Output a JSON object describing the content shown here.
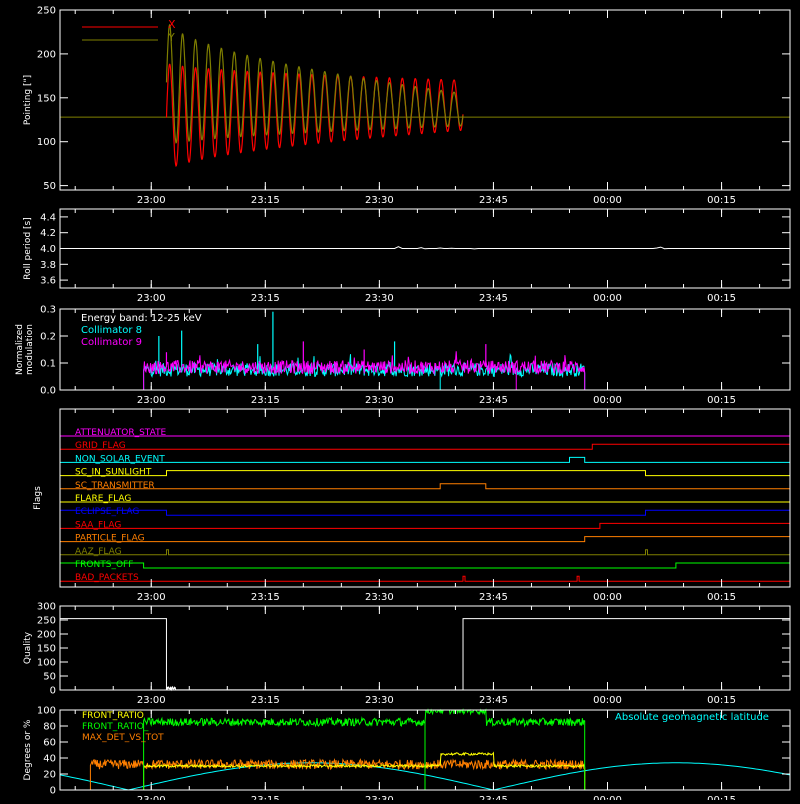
{
  "colors": {
    "background": "#000000",
    "axis": "#ffffff",
    "red": "#ff0000",
    "olive": "#7f7f00",
    "cyan": "#00ffff",
    "magenta": "#ff00ff",
    "white": "#ffffff",
    "yellow": "#ffff00",
    "green": "#00ff00",
    "orange": "#ff7f00",
    "blue": "#0000ff"
  },
  "time_axis": {
    "start": "22:48",
    "end": "00:24",
    "tick_labels": [
      "23:00",
      "23:15",
      "23:30",
      "23:45",
      "00:00",
      "00:15"
    ]
  },
  "chart_data": [
    {
      "id": "pointing",
      "type": "area",
      "ylabel": "Pointing [\"]",
      "ylim": [
        45,
        250
      ],
      "y_ticks": [
        50,
        100,
        150,
        200,
        250
      ],
      "series": [
        {
          "name": "X",
          "color": "#ff0000",
          "baseline": 128,
          "active_from": "23:02",
          "active_to": "23:41",
          "start_low": 65,
          "start_high": 190,
          "end_low": 113,
          "end_high": 170
        },
        {
          "name": "Y",
          "color": "#7f7f00",
          "baseline": 128,
          "active_from": "23:02",
          "active_to": "23:41",
          "start_low": 95,
          "start_high": 240,
          "end_low": 118,
          "end_high": 155
        }
      ]
    },
    {
      "id": "roll",
      "type": "line",
      "ylabel": "Roll period [s]",
      "ylim": [
        3.5,
        4.5
      ],
      "y_ticks": [
        3.6,
        3.8,
        4.0,
        4.2,
        4.4
      ],
      "series": [
        {
          "name": "",
          "color": "#ffffff",
          "value": 4.0
        }
      ]
    },
    {
      "id": "modulation",
      "type": "line",
      "ylabel": "Normalized modulation",
      "ylim": [
        0,
        0.3
      ],
      "y_ticks": [
        0.0,
        0.1,
        0.2,
        0.3
      ],
      "legend_title": "Energy band: 12-25 keV",
      "series": [
        {
          "name": "Collimator 8",
          "color": "#00ffff",
          "active_from": "22:59",
          "active_to": "23:57",
          "baseline": 0.075,
          "noise": 0.05,
          "spikes": [
            [
              "23:01",
              0.2
            ],
            [
              "23:04",
              0.22
            ],
            [
              "23:16",
              0.29
            ],
            [
              "23:14",
              0.17
            ],
            [
              "23:32",
              0.18
            ]
          ]
        },
        {
          "name": "Collimator 9",
          "color": "#ff00ff",
          "active_from": "22:59",
          "active_to": "23:57",
          "baseline": 0.085,
          "noise": 0.05,
          "spikes": [
            [
              "23:02",
              0.14
            ],
            [
              "23:20",
              0.18
            ],
            [
              "23:28",
              0.15
            ],
            [
              "23:44",
              0.17
            ]
          ]
        }
      ]
    },
    {
      "id": "flags",
      "type": "line",
      "ylabel": "Flags",
      "series": [
        {
          "name": "ATTENUATOR_STATE",
          "color": "#ff00ff",
          "on": []
        },
        {
          "name": "GRID_FLAG",
          "color": "#ff0000",
          "on": [
            [
              "23:58",
              "00:24"
            ]
          ]
        },
        {
          "name": "NON_SOLAR_EVENT",
          "color": "#00ffff",
          "on": [
            [
              "23:55",
              "23:57"
            ]
          ]
        },
        {
          "name": "SC_IN_SUNLIGHT",
          "color": "#ffff00",
          "on": [
            [
              "23:02",
              "00:05"
            ]
          ]
        },
        {
          "name": "SC_TRANSMITTER",
          "color": "#ff7f00",
          "on": [
            [
              "23:38",
              "23:44"
            ]
          ]
        },
        {
          "name": "FLARE_FLAG",
          "color": "#ffff00",
          "on": []
        },
        {
          "name": "ECLIPSE_FLAG",
          "color": "#0000ff",
          "on": [
            [
              "22:48",
              "23:02"
            ],
            [
              "00:05",
              "00:24"
            ]
          ]
        },
        {
          "name": "SAA_FLAG",
          "color": "#ff0000",
          "on": [
            [
              "23:59",
              "00:24"
            ]
          ]
        },
        {
          "name": "PARTICLE_FLAG",
          "color": "#ff7f00",
          "on": [
            [
              "23:57",
              "00:24"
            ]
          ]
        },
        {
          "name": "AAZ_FLAG",
          "color": "#7f7f00",
          "on": [
            [
              "23:02",
              "23:02"
            ],
            [
              "00:05",
              "00:05"
            ]
          ]
        },
        {
          "name": "FRONTS_OFF",
          "color": "#00ff00",
          "on": [
            [
              "22:48",
              "22:59"
            ],
            [
              "00:09",
              "00:24"
            ]
          ]
        },
        {
          "name": "BAD_PACKETS",
          "color": "#ff0000",
          "on": [
            [
              "23:41",
              "23:41"
            ],
            [
              "23:56",
              "23:56"
            ]
          ]
        }
      ]
    },
    {
      "id": "quality",
      "type": "line",
      "ylabel": "Quality",
      "ylim": [
        0,
        300
      ],
      "y_ticks": [
        0,
        50,
        100,
        150,
        200,
        250,
        300
      ],
      "series": [
        {
          "name": "",
          "color": "#ffffff",
          "on_value": 255,
          "off_from": "23:02",
          "off_to": "23:41"
        }
      ]
    },
    {
      "id": "ratios",
      "type": "line",
      "ylabel": "Degrees or %",
      "ylim": [
        0,
        100
      ],
      "y_ticks": [
        0,
        20,
        40,
        60,
        80,
        100
      ],
      "annotation": "Absolute geomagnetic latitude",
      "series": [
        {
          "name": "FRONT_RATIO",
          "color": "#ffff00",
          "active_from": "22:59",
          "active_to": "23:57",
          "level": 30,
          "high_from": "23:38",
          "high_to": "23:45",
          "high_level": 45
        },
        {
          "name": "FRONT_RATIO_",
          "color": "#00ff00",
          "active_from": "22:59",
          "active_to": "23:57",
          "level": 85,
          "high_from": "23:36",
          "high_to": "23:44",
          "high_level": 100
        },
        {
          "name": "MAX_DET_VS_TOT",
          "color": "#ff7f00",
          "active_from": "22:52",
          "active_to": "23:57",
          "level": 32
        },
        {
          "name": "Absolute geomagnetic latitude",
          "color": "#00ffff",
          "min": 0,
          "max": 34,
          "period_minutes": 48
        }
      ]
    }
  ]
}
